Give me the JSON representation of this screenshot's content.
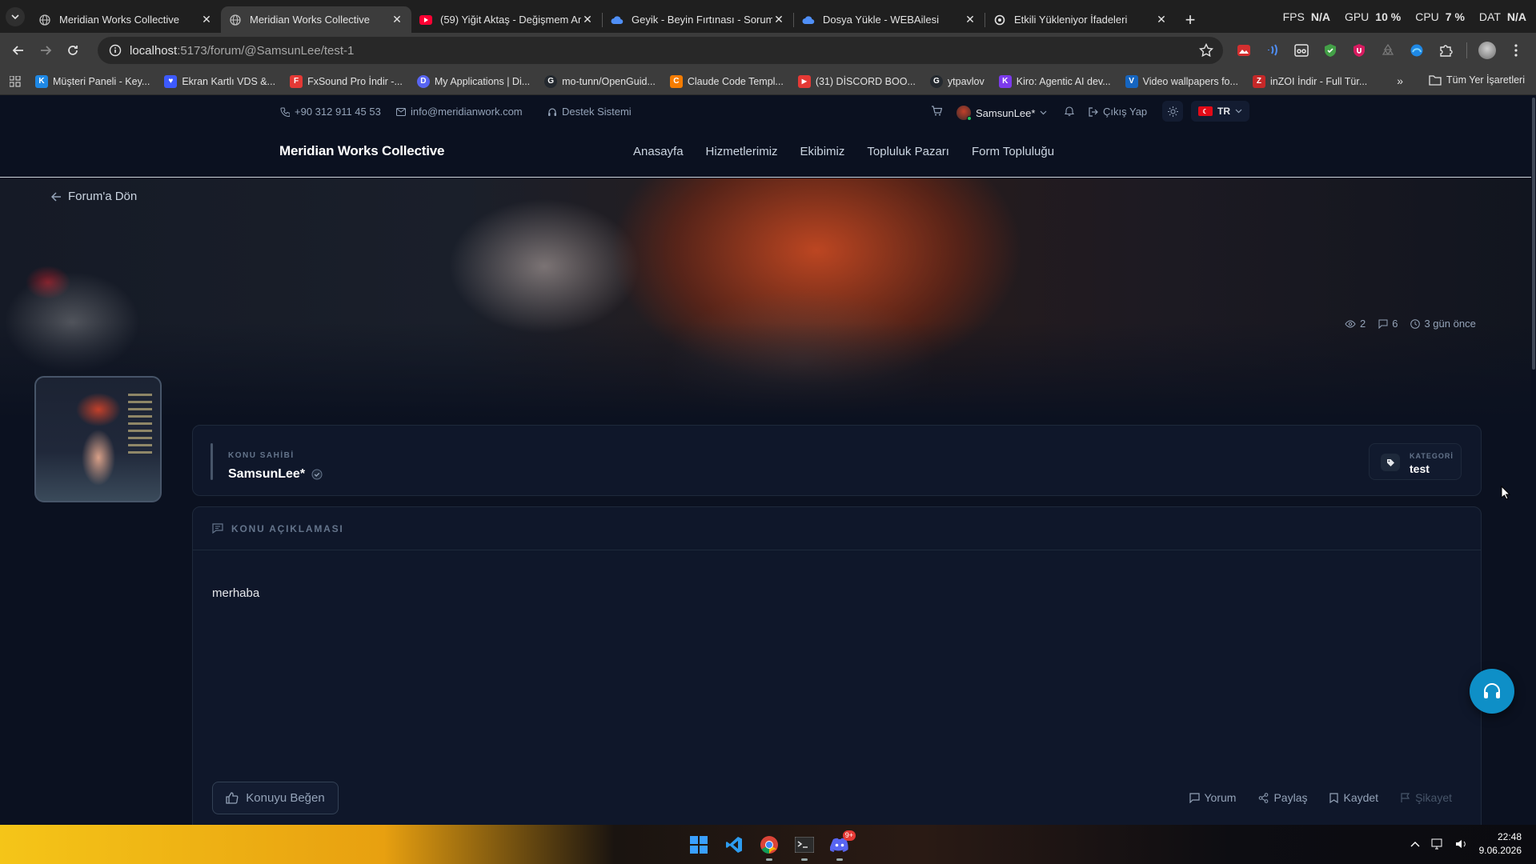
{
  "browser": {
    "tabs": [
      {
        "title": "Meridian Works Collective",
        "active": false
      },
      {
        "title": "Meridian Works Collective",
        "active": true
      },
      {
        "title": "(59) Yiğit Aktaş - Değişmem An",
        "active": false
      },
      {
        "title": "Geyik - Beyin Fırtınası - Sorum",
        "active": false
      },
      {
        "title": "Dosya Yükle - WEBAilesi",
        "active": false
      },
      {
        "title": "Etkili Yükleniyor İfadeleri",
        "active": false
      }
    ],
    "perf": {
      "fps_label": "FPS",
      "fps_value": "N/A",
      "gpu_label": "GPU",
      "gpu_value": "10 %",
      "cpu_label": "CPU",
      "cpu_value": "7 %",
      "dat_label": "DAT",
      "dat_value": "N/A"
    },
    "url_host": "localhost",
    "url_path": ":5173/forum/@SamsunLee/test-1",
    "bookmarks": [
      {
        "label": "Müşteri Paneli - Key...",
        "color": "#1e88e5",
        "glyph": "K"
      },
      {
        "label": "Ekran Kartlı VDS &...",
        "color": "#3d5afe",
        "glyph": "♥"
      },
      {
        "label": "FxSound Pro İndir -...",
        "color": "#e53935",
        "glyph": "F"
      },
      {
        "label": "My Applications | Di...",
        "color": "#5865f2",
        "glyph": "D"
      },
      {
        "label": "mo-tunn/OpenGuid...",
        "color": "#24292f",
        "glyph": "G"
      },
      {
        "label": "Claude Code Templ...",
        "color": "#f57c00",
        "glyph": "C"
      },
      {
        "label": "(31) DİSCORD BOO...",
        "color": "#e53935",
        "glyph": "▶"
      },
      {
        "label": "ytpavlov",
        "color": "#24292f",
        "glyph": "G"
      },
      {
        "label": "Kiro: Agentic AI dev...",
        "color": "#7c3aed",
        "glyph": "K"
      },
      {
        "label": "Video wallpapers fo...",
        "color": "#1565c0",
        "glyph": "V"
      },
      {
        "label": "inZOI İndir - Full Tür...",
        "color": "#c62828",
        "glyph": "Z"
      }
    ],
    "bookmarks_all": "Tüm Yer İşaretleri"
  },
  "topbar": {
    "phone": "+90 312 911 45 53",
    "email": "info@meridianwork.com",
    "support": "Destek Sistemi",
    "user": "SamsunLee*",
    "logout": "Çıkış Yap",
    "lang": "TR"
  },
  "nav": {
    "brand": "Meridian Works Collective",
    "links": [
      "Anasayfa",
      "Hizmetlerimiz",
      "Ekibimiz",
      "Topluluk Pazarı",
      "Form Topluluğu"
    ]
  },
  "post": {
    "back": "Forum'a Dön",
    "views": "2",
    "comments": "6",
    "time": "3 gün önce",
    "owner_label": "KONU SAHİBİ",
    "owner_name": "SamsunLee*",
    "category_label": "KATEGORİ",
    "category_value": "test",
    "desc_label": "KONU AÇIKLAMASI",
    "body": "merhaba",
    "like": "Konuyu Beğen",
    "actions": {
      "comment": "Yorum",
      "share": "Paylaş",
      "save": "Kaydet",
      "report": "Şikayet"
    }
  },
  "taskbar": {
    "time": "22:48",
    "date": "9.06.2026",
    "discord_badge": "9+"
  },
  "colors": {
    "accent": "#0e8fc7",
    "page_bg": "#0b1120",
    "card_bg": "#0f172a"
  }
}
